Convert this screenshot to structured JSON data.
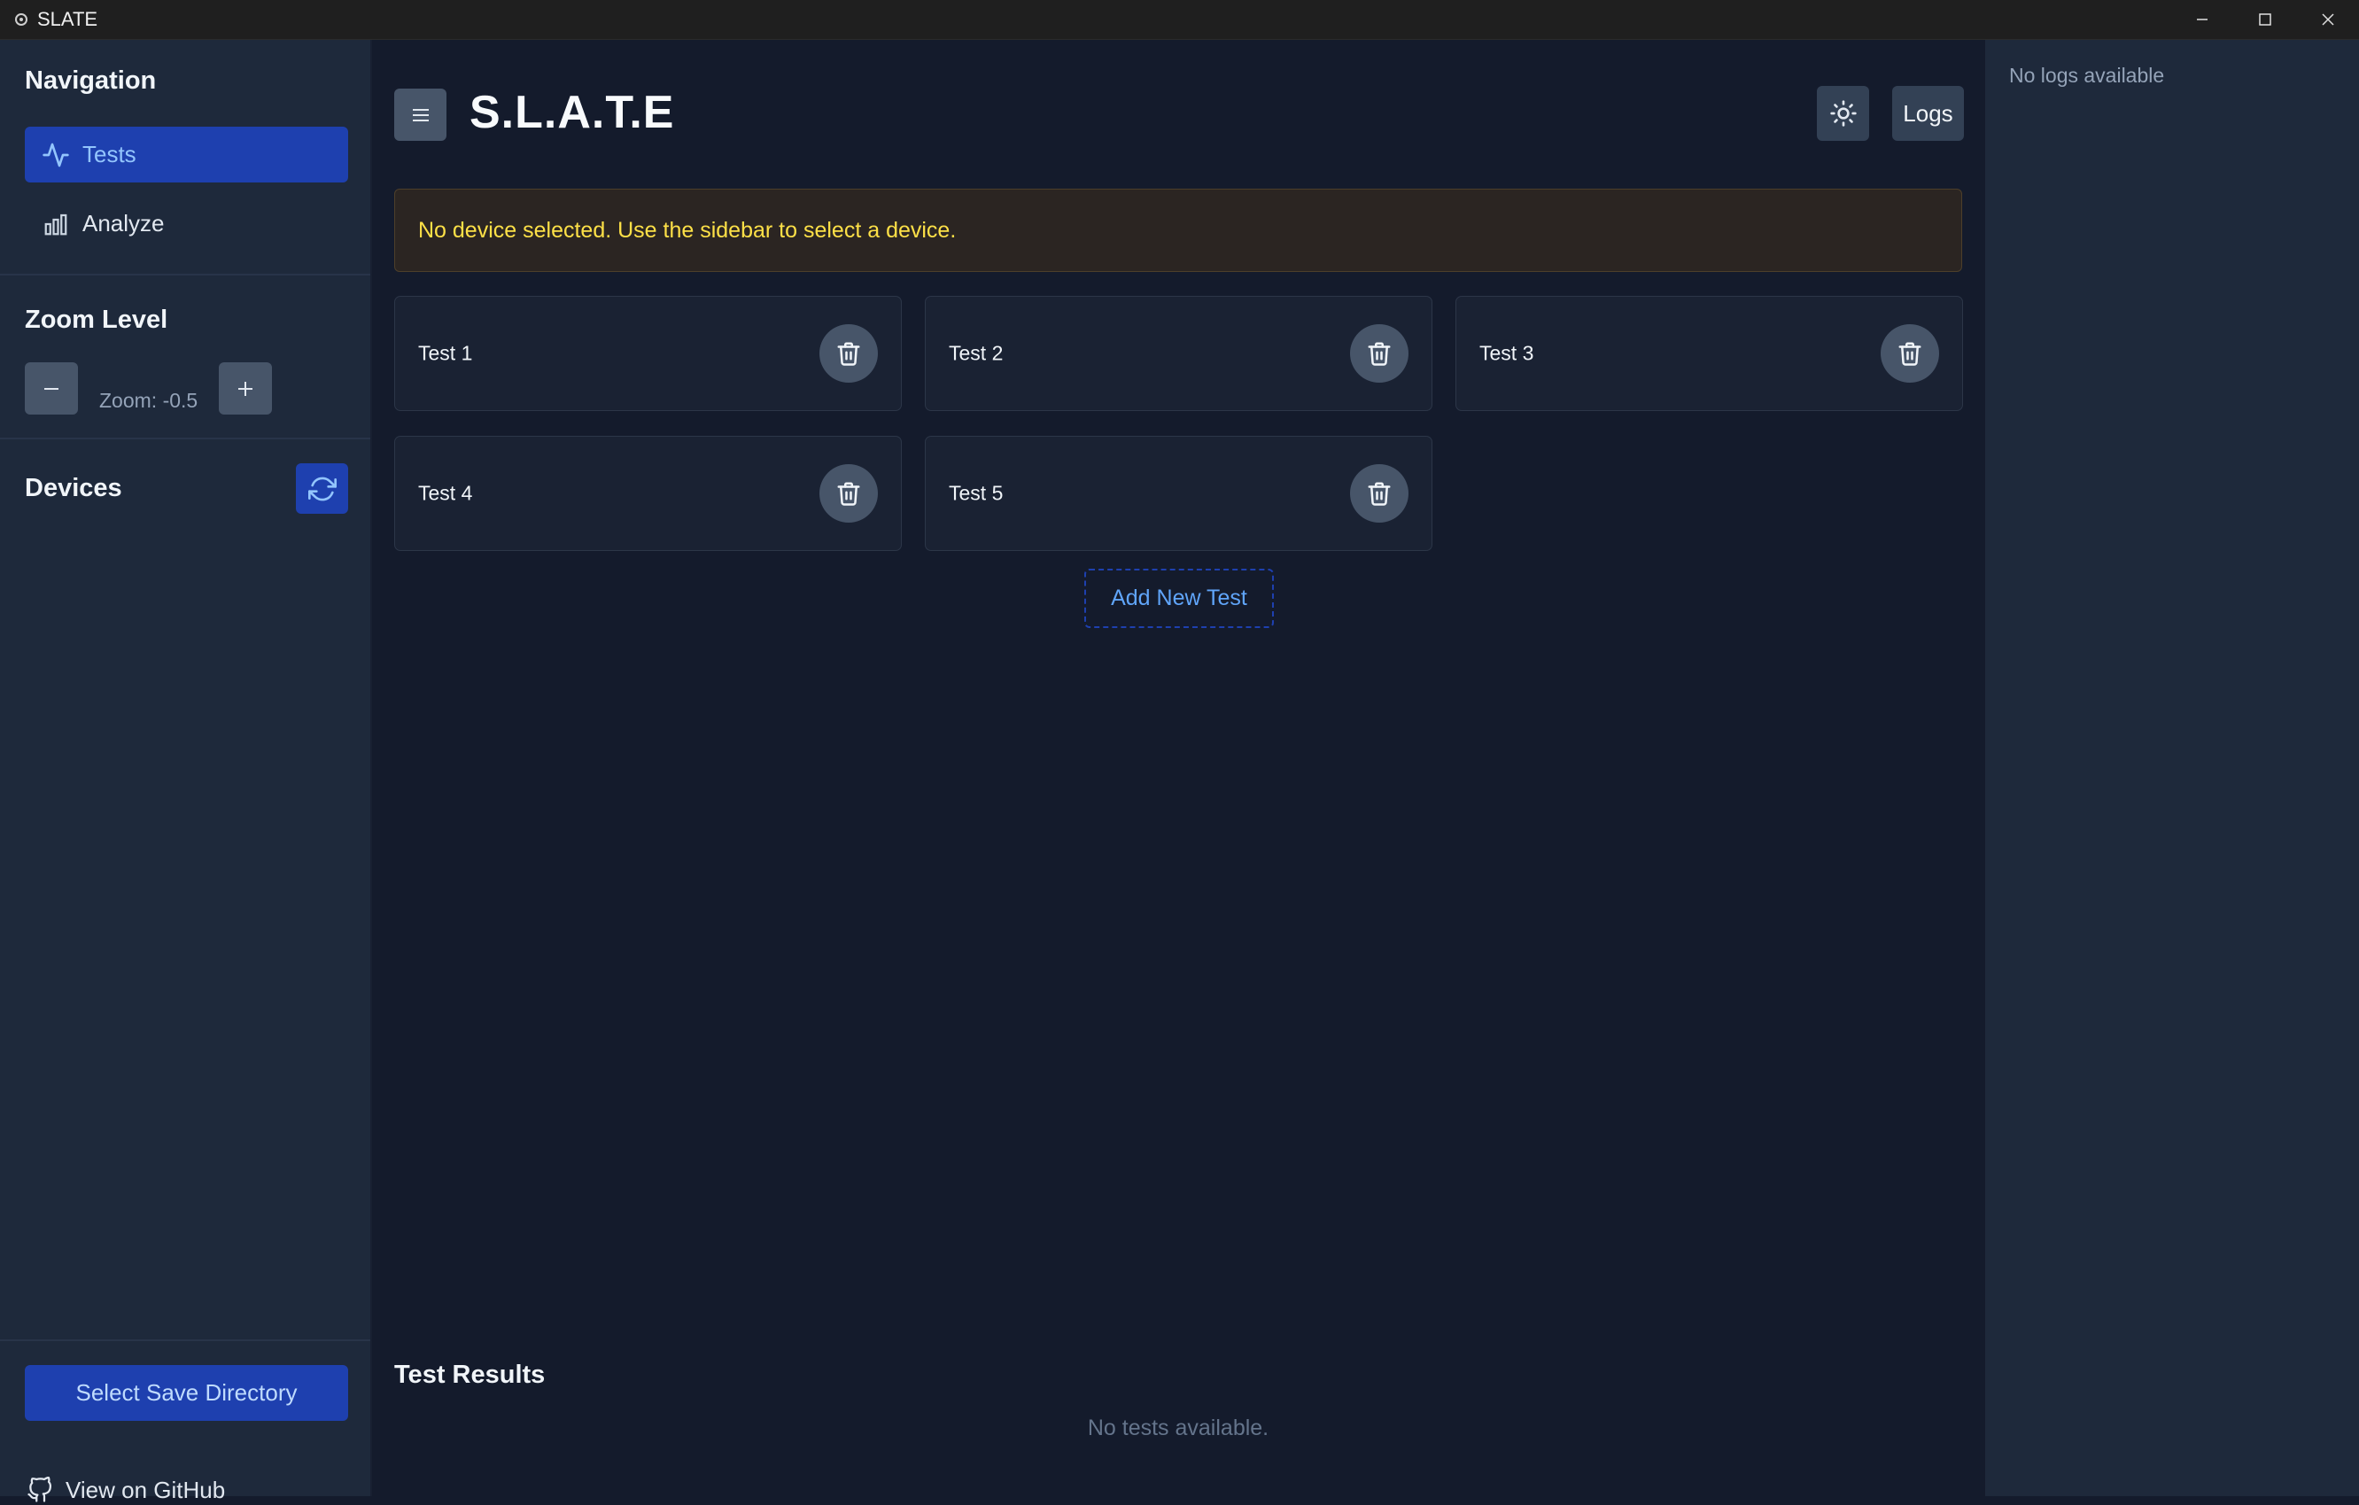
{
  "window": {
    "title": "SLATE"
  },
  "sidebar": {
    "navigation_title": "Navigation",
    "nav_items": [
      {
        "label": "Tests",
        "icon": "activity-icon",
        "active": true
      },
      {
        "label": "Analyze",
        "icon": "bar-chart-icon",
        "active": false
      }
    ],
    "zoom": {
      "title": "Zoom Level",
      "text": "Zoom: -0.5"
    },
    "devices": {
      "title": "Devices"
    },
    "save_directory_label": "Select Save Directory",
    "github_label": "View on GitHub"
  },
  "header": {
    "title": "S.L.A.T.E",
    "logs_label": "Logs"
  },
  "alert": {
    "text": "No device selected. Use the sidebar to select a device."
  },
  "tests": [
    {
      "name": "Test 1"
    },
    {
      "name": "Test 2"
    },
    {
      "name": "Test 3"
    },
    {
      "name": "Test 4"
    },
    {
      "name": "Test 5"
    }
  ],
  "add_test_label": "Add New Test",
  "results": {
    "title": "Test Results",
    "empty_text": "No tests available."
  },
  "logs": {
    "empty_text": "No logs available"
  },
  "colors": {
    "accent": "#1e40af",
    "accent_text": "#93c5fd",
    "warning_text": "#fde047",
    "sidebar_bg": "#1e293b",
    "main_bg": "#141b2c"
  }
}
